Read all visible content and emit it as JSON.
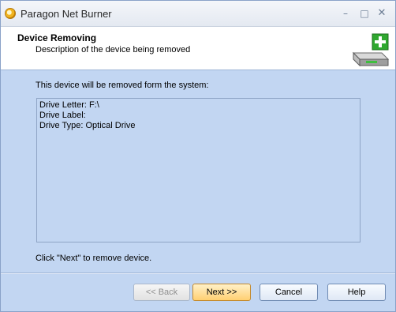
{
  "window": {
    "title": "Paragon Net Burner",
    "controls": {
      "minimize": "–",
      "maximize": "□",
      "close": "✕"
    }
  },
  "header": {
    "title": "Device Removing",
    "description": "Description of the device being removed",
    "icon": "drive-add-icon"
  },
  "body": {
    "intro": "This device will be removed form the system:",
    "details": [
      "Drive Letter: F:\\",
      "Drive Label:",
      "Drive Type: Optical Drive"
    ],
    "footnote": "Click \"Next\" to remove device."
  },
  "buttons": {
    "back": "<< Back",
    "next": "Next >>",
    "cancel": "Cancel",
    "help": "Help"
  },
  "colors": {
    "background": "#c2d6f2",
    "accent_button": "#ffcf72"
  }
}
